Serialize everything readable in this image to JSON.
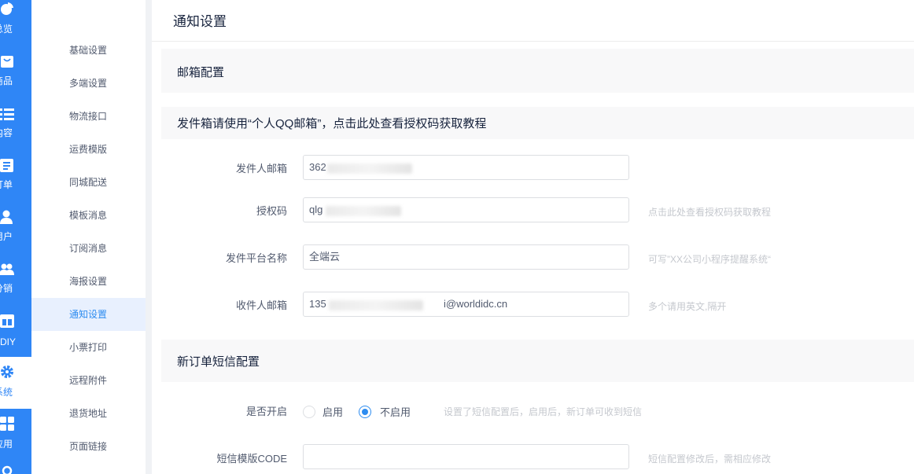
{
  "sidebar": {
    "items": [
      {
        "label": "总览",
        "icon": "pie-chart-icon"
      },
      {
        "label": "商品",
        "icon": "shopping-bag-icon"
      },
      {
        "label": "内容",
        "icon": "list-icon"
      },
      {
        "label": "订单",
        "icon": "order-doc-icon"
      },
      {
        "label": "用户",
        "icon": "user-icon"
      },
      {
        "label": "分销",
        "icon": "users-icon"
      },
      {
        "label": "DIY",
        "icon": "layout-icon"
      },
      {
        "label": "系统",
        "icon": "gear-icon"
      },
      {
        "label": "应用",
        "icon": "grid-icon"
      }
    ],
    "active": "系统"
  },
  "submenu": {
    "items": [
      "基础设置",
      "多端设置",
      "物流接口",
      "运费模版",
      "同城配送",
      "模板消息",
      "订阅消息",
      "海报设置",
      "通知设置",
      "小票打印",
      "远程附件",
      "退货地址",
      "页面链接"
    ],
    "active": "通知设置"
  },
  "page": {
    "title": "通知设置",
    "email_section": "邮箱配置",
    "email_tip": "发件箱请使用“个人QQ邮箱”，点击此处查看授权码获取教程",
    "fields": {
      "sender_email": {
        "label": "发件人邮箱",
        "value": "362"
      },
      "auth_code": {
        "label": "授权码",
        "value": "qlg",
        "hint": "点击此处查看授权码获取教程"
      },
      "platform_name": {
        "label": "发件平台名称",
        "value": "全端云",
        "hint": "可写”XX公司小程序提醒系统“"
      },
      "receiver_email": {
        "label": "收件人邮箱",
        "value_prefix": "135",
        "value_suffix": "i@worldidc.cn",
        "hint": "多个请用英文,隔开"
      }
    },
    "sms_section": "新订单短信配置",
    "sms_enable": {
      "label": "是否开启",
      "options": [
        "启用",
        "不启用"
      ],
      "selected": "不启用",
      "hint": "设置了短信配置后，启用后，新订单可收到短信"
    },
    "sms_template": {
      "label": "短信模版CODE",
      "value": "",
      "hint": "短信配置修改后，需相应修改"
    }
  },
  "colors": {
    "primary": "#2f86f6",
    "active_text": "#2d8cf0",
    "hint": "#c5c8ce"
  }
}
